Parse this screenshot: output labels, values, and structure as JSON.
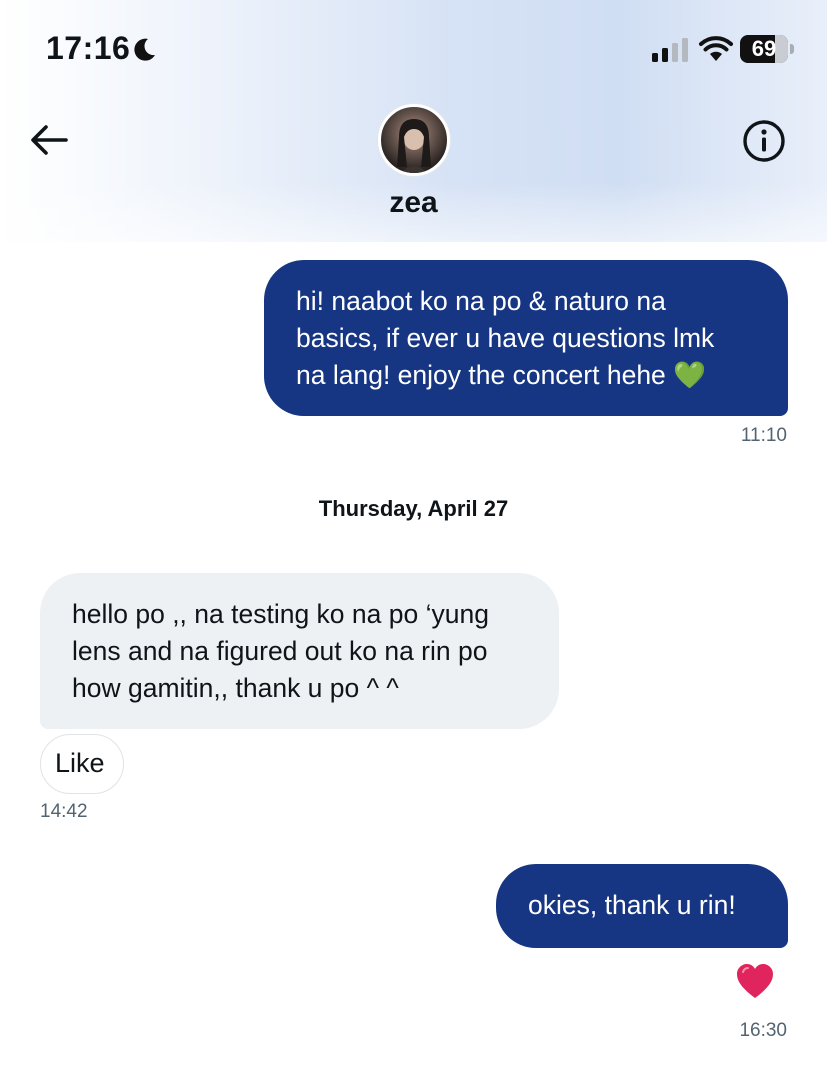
{
  "status_bar": {
    "time": "17:16",
    "battery": "69",
    "icons": [
      "moon-icon",
      "cellular-signal-icon",
      "wifi-icon",
      "battery-icon"
    ]
  },
  "header": {
    "name": "zea",
    "icons": [
      "back-arrow-icon",
      "info-icon"
    ]
  },
  "messages": [
    {
      "direction": "sent",
      "lines": [
        "hi! naabot ko na po & naturo na",
        "basics, if ever u have questions lmk",
        "na lang! enjoy the concert hehe 💚"
      ],
      "time": "11:10"
    },
    {
      "direction": "received",
      "lines": [
        "hello po ,, na testing ko na po ‘yung",
        "lens and na figured out ko na rin po",
        "how gamitin,, thank u po ^ ^"
      ],
      "reaction_button": "Like",
      "time": "14:42"
    },
    {
      "direction": "sent",
      "lines": [
        "okies, thank u rin!"
      ],
      "reaction": "❤️",
      "time": "16:30"
    }
  ],
  "date_divider": "Thursday, April 27",
  "colors": {
    "sent_bubble": "#163683",
    "received_bubble": "#eef1f3",
    "timestamp": "#536471",
    "reaction_heart": "#e0245e"
  }
}
